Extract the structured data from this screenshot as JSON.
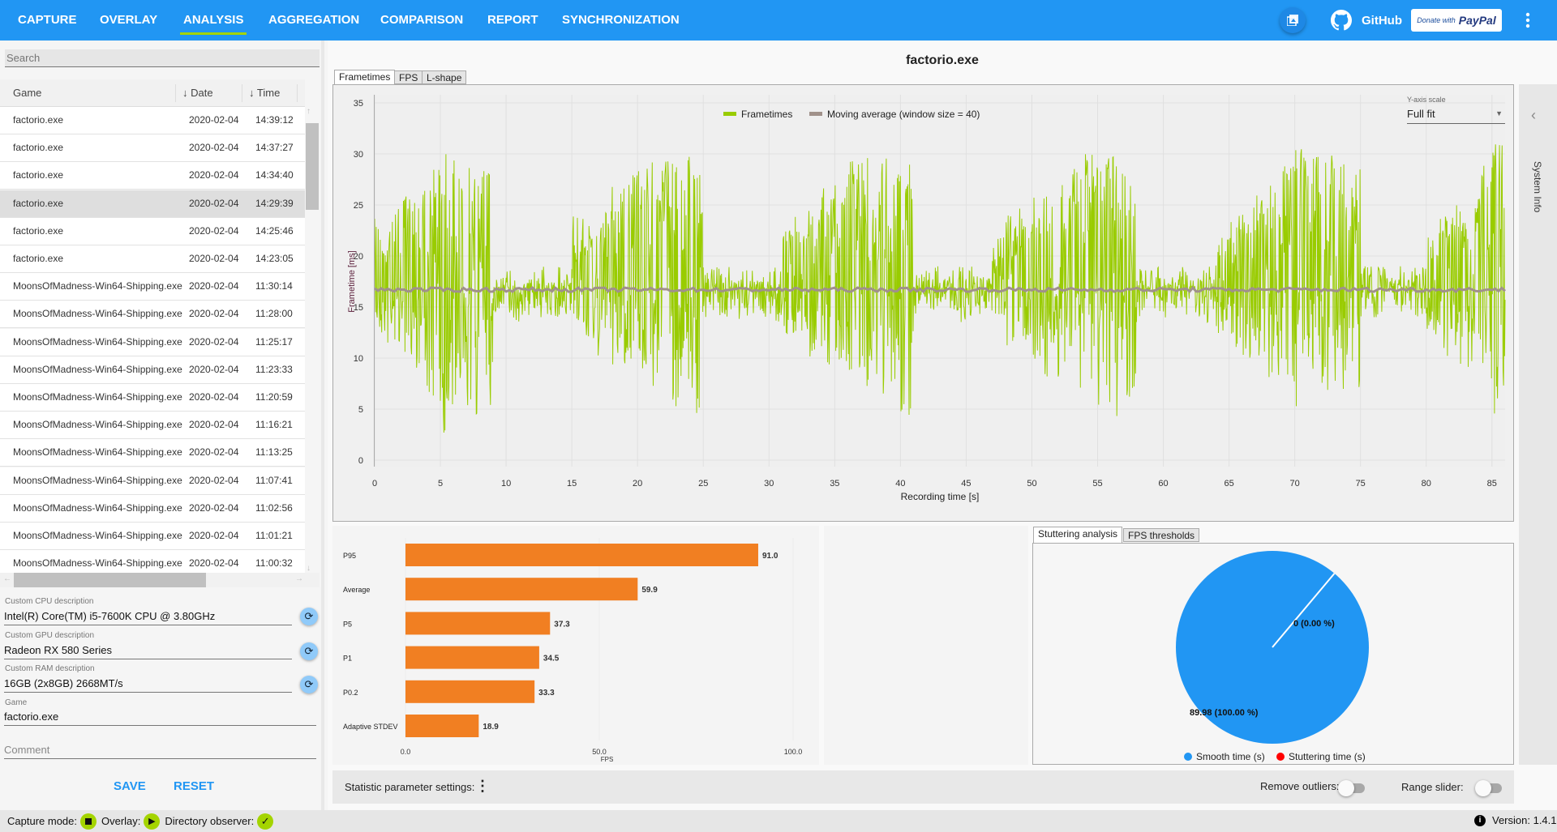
{
  "nav": {
    "tabs": [
      "CAPTURE",
      "OVERLAY",
      "ANALYSIS",
      "AGGREGATION",
      "COMPARISON",
      "REPORT",
      "SYNCHRONIZATION"
    ],
    "active": "ANALYSIS",
    "github_label": "GitHub",
    "donate_prefix": "Donate with",
    "donate_brand": "PayPal",
    "icons": [
      "image-gallery-icon",
      "github-icon",
      "more-vert-icon"
    ]
  },
  "sidebar": {
    "search_placeholder": "Search",
    "columns": {
      "game": "Game",
      "date": "Date",
      "time": "Time"
    },
    "rows": [
      {
        "game": "factorio.exe",
        "date": "2020-02-04",
        "time": "14:39:12"
      },
      {
        "game": "factorio.exe",
        "date": "2020-02-04",
        "time": "14:37:27"
      },
      {
        "game": "factorio.exe",
        "date": "2020-02-04",
        "time": "14:34:40"
      },
      {
        "game": "factorio.exe",
        "date": "2020-02-04",
        "time": "14:29:39",
        "selected": true
      },
      {
        "game": "factorio.exe",
        "date": "2020-02-04",
        "time": "14:25:46"
      },
      {
        "game": "factorio.exe",
        "date": "2020-02-04",
        "time": "14:23:05"
      },
      {
        "game": "MoonsOfMadness-Win64-Shipping.exe",
        "date": "2020-02-04",
        "time": "11:30:14"
      },
      {
        "game": "MoonsOfMadness-Win64-Shipping.exe",
        "date": "2020-02-04",
        "time": "11:28:00"
      },
      {
        "game": "MoonsOfMadness-Win64-Shipping.exe",
        "date": "2020-02-04",
        "time": "11:25:17"
      },
      {
        "game": "MoonsOfMadness-Win64-Shipping.exe",
        "date": "2020-02-04",
        "time": "11:23:33"
      },
      {
        "game": "MoonsOfMadness-Win64-Shipping.exe",
        "date": "2020-02-04",
        "time": "11:20:59"
      },
      {
        "game": "MoonsOfMadness-Win64-Shipping.exe",
        "date": "2020-02-04",
        "time": "11:16:21"
      },
      {
        "game": "MoonsOfMadness-Win64-Shipping.exe",
        "date": "2020-02-04",
        "time": "11:13:25"
      },
      {
        "game": "MoonsOfMadness-Win64-Shipping.exe",
        "date": "2020-02-04",
        "time": "11:07:41"
      },
      {
        "game": "MoonsOfMadness-Win64-Shipping.exe",
        "date": "2020-02-04",
        "time": "11:02:56"
      },
      {
        "game": "MoonsOfMadness-Win64-Shipping.exe",
        "date": "2020-02-04",
        "time": "11:01:21"
      },
      {
        "game": "MoonsOfMadness-Win64-Shipping.exe",
        "date": "2020-02-04",
        "time": "11:00:32"
      }
    ],
    "fields": {
      "cpu_label": "Custom CPU description",
      "cpu_value": "Intel(R) Core(TM) i5-7600K CPU @ 3.80GHz",
      "gpu_label": "Custom GPU description",
      "gpu_value": "Radeon RX 580 Series",
      "ram_label": "Custom RAM description",
      "ram_value": "16GB (2x8GB) 2668MT/s",
      "game_label": "Game",
      "game_value": "factorio.exe",
      "comment_placeholder": "Comment"
    },
    "save_label": "SAVE",
    "reset_label": "RESET"
  },
  "main": {
    "title": "factorio.exe",
    "chart_tabs": [
      "Frametimes",
      "FPS",
      "L-shape"
    ],
    "yscale_label": "Y-axis scale",
    "yscale_value": "Full fit",
    "system_info_label": "System Info",
    "stutter_tabs": [
      "Stuttering analysis",
      "FPS thresholds"
    ],
    "settings_label": "Statistic parameter settings:",
    "remove_outliers_label": "Remove outliers:",
    "remove_outliers_on": false,
    "range_slider_label": "Range slider:",
    "range_slider_on": false
  },
  "status": {
    "capture_label": "Capture mode:",
    "overlay_label": "Overlay:",
    "observer_label": "Directory observer:",
    "version": "Version: 1.4.1"
  },
  "chart_data": [
    {
      "type": "line",
      "xlabel": "Recording time [s]",
      "ylabel": "Frametime [ms]",
      "xlim": [
        0,
        86
      ],
      "ylim": [
        0,
        35
      ],
      "xticks": [
        0,
        5,
        10,
        15,
        20,
        25,
        30,
        35,
        40,
        45,
        50,
        55,
        60,
        65,
        70,
        75,
        80,
        85
      ],
      "yticks": [
        0,
        5,
        10,
        15,
        20,
        25,
        30,
        35
      ],
      "grid": true,
      "legend_position": "top",
      "series": [
        {
          "name": "Frametimes",
          "color": "#99CC00",
          "per_second_max": [
            24,
            25,
            26,
            28,
            29,
            31,
            30,
            29,
            29,
            19,
            19,
            18,
            19,
            18,
            19,
            24,
            24,
            25,
            27,
            28,
            29,
            30,
            30,
            30,
            29,
            19,
            19,
            18,
            19,
            18,
            19,
            23,
            24,
            25,
            27,
            28,
            30,
            30,
            30,
            29,
            29,
            19,
            19,
            18,
            19,
            19,
            18,
            22,
            24,
            25,
            26,
            27,
            28,
            29,
            30,
            30,
            30,
            29,
            19,
            19,
            18,
            19,
            18,
            19,
            22,
            24,
            25,
            26,
            27,
            29,
            31,
            30,
            31,
            29,
            29,
            19,
            19,
            18,
            19,
            19,
            22,
            24,
            25,
            26,
            29,
            31,
            29
          ],
          "per_second_min": [
            12,
            11,
            10,
            9,
            6,
            2.5,
            5,
            4,
            5,
            14,
            13.5,
            14,
            14,
            13.5,
            14,
            12,
            11,
            10,
            9,
            8,
            8,
            7,
            5,
            6,
            4,
            14,
            14,
            13.5,
            14,
            14,
            13.5,
            12,
            12,
            10,
            9,
            9,
            8,
            7,
            6,
            6,
            4,
            14,
            14,
            14,
            13.5,
            14,
            14,
            12,
            11,
            10,
            9,
            8,
            8,
            7,
            5,
            5,
            4,
            5,
            14,
            14,
            13.5,
            14,
            14,
            13.5,
            12,
            11,
            10,
            9,
            8,
            7,
            5,
            6,
            6,
            6,
            4,
            14,
            14,
            14,
            13.5,
            14,
            12,
            10,
            9,
            9,
            8,
            4.5,
            6
          ]
        },
        {
          "name": "Moving average (window size = 40)",
          "color": "#A0918A",
          "level": 16.7
        }
      ]
    },
    {
      "type": "bar",
      "orientation": "horizontal",
      "categories": [
        "P95",
        "Average",
        "P5",
        "P1",
        "P0.2",
        "Adaptive STDEV"
      ],
      "values": [
        91.0,
        59.9,
        37.3,
        34.5,
        33.3,
        18.9
      ],
      "xlabel": "FPS",
      "xlim": [
        0,
        100
      ],
      "xticks": [
        "0.0",
        "50.0",
        "100.0"
      ],
      "color": "#F17F22"
    },
    {
      "type": "pie",
      "slices": [
        {
          "name": "Smooth time (s)",
          "value": 89.98,
          "label": "89.98 (100.00 %)",
          "color": "#2196F3"
        },
        {
          "name": "Stuttering time (s)",
          "value": 0,
          "label": "0 (0.00 %)",
          "color": "#FF0000"
        }
      ],
      "legend_position": "bottom"
    }
  ]
}
